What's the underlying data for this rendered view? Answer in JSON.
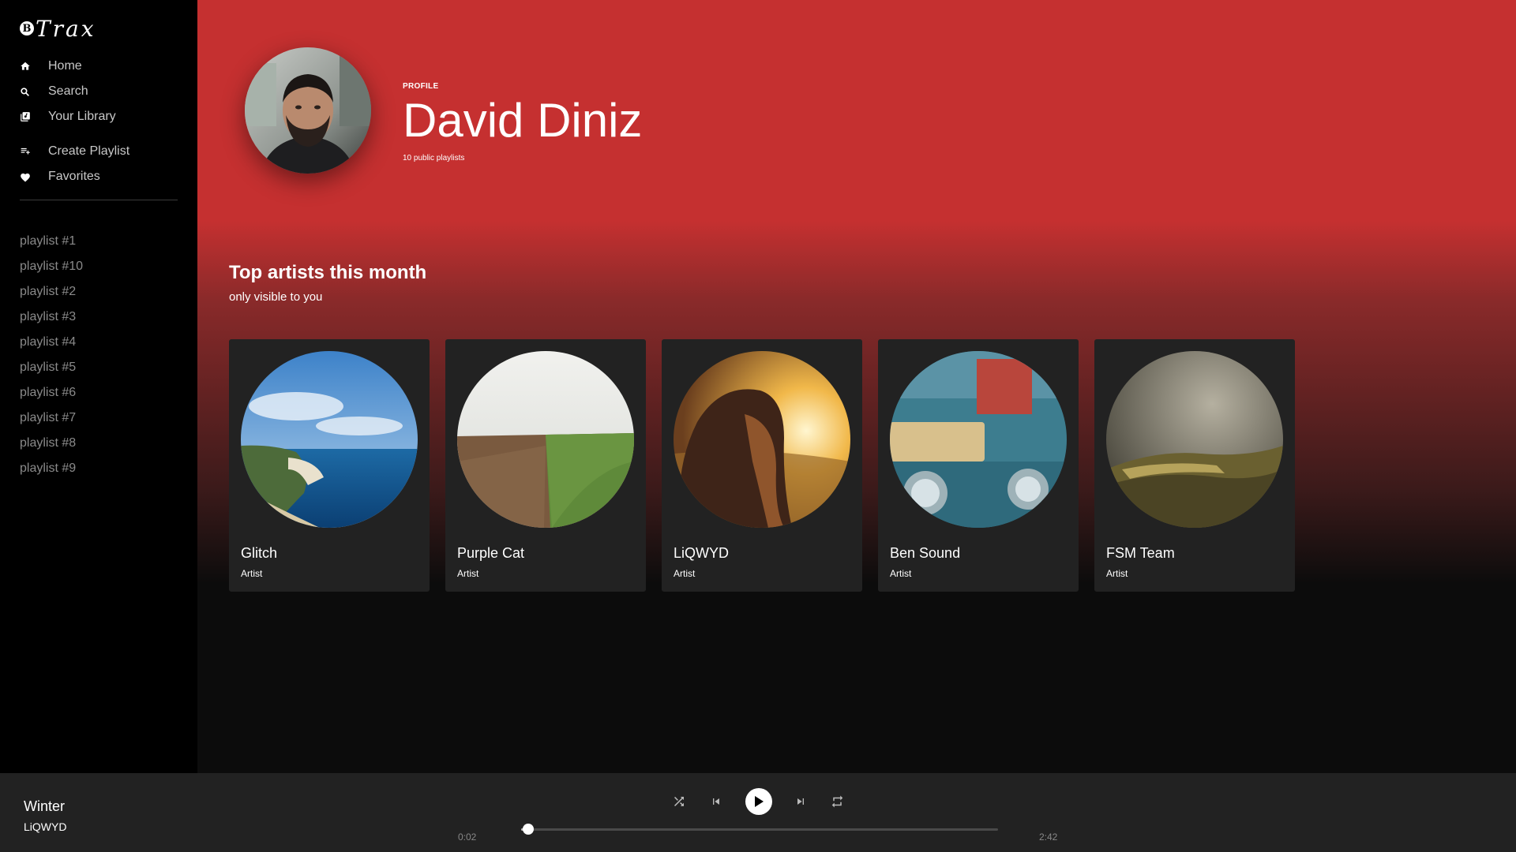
{
  "app": {
    "logo_text": "Trax",
    "logo_mark": "B"
  },
  "sidebar": {
    "nav": [
      {
        "label": "Home",
        "icon": "home-icon"
      },
      {
        "label": "Search",
        "icon": "search-icon"
      },
      {
        "label": "Your Library",
        "icon": "library-icon"
      }
    ],
    "actions": [
      {
        "label": "Create Playlist",
        "icon": "playlist-add-icon"
      },
      {
        "label": "Favorites",
        "icon": "heart-icon"
      }
    ],
    "playlists": [
      "playlist #1",
      "playlist #10",
      "playlist #2",
      "playlist #3",
      "playlist #4",
      "playlist #5",
      "playlist #6",
      "playlist #7",
      "playlist #8",
      "playlist #9"
    ]
  },
  "profile": {
    "kicker": "PROFILE",
    "name": "David Diniz",
    "subtitle": "10 public playlists"
  },
  "section": {
    "title": "Top artists this month",
    "subtitle": "only visible to you"
  },
  "artists": [
    {
      "name": "Glitch",
      "type": "Artist"
    },
    {
      "name": "Purple Cat",
      "type": "Artist"
    },
    {
      "name": "LiQWYD",
      "type": "Artist"
    },
    {
      "name": "Ben Sound",
      "type": "Artist"
    },
    {
      "name": "FSM Team",
      "type": "Artist"
    }
  ],
  "player": {
    "title": "Winter",
    "artist": "LiQWYD",
    "current_time": "0:02",
    "total_time": "2:42",
    "progress": 0.012
  },
  "colors": {
    "accent": "#c53030",
    "sidebar": "#000000",
    "card": "#222222",
    "player": "#222222"
  }
}
